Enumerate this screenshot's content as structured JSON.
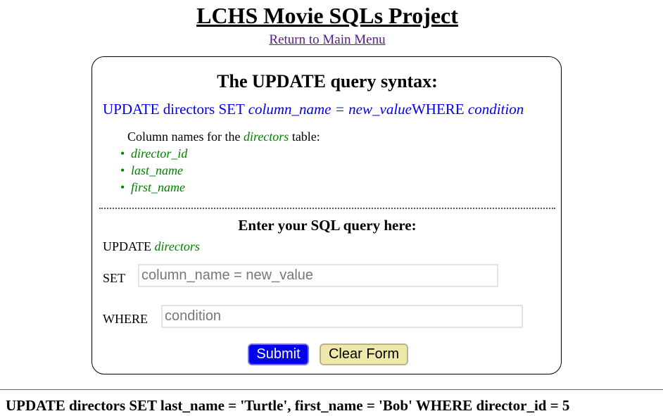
{
  "header": {
    "title": "LCHS Movie SQLs Project",
    "menu_link": "Return to Main Menu"
  },
  "syntax": {
    "title": "The UPDATE query syntax:",
    "kw_update": "UPDATE directors SET",
    "col_value": "column_name = new_value",
    "kw_where": "WHERE",
    "cond": "condition"
  },
  "columns": {
    "intro_prefix": "Column names for the",
    "table_name": "directors",
    "intro_suffix": "table:",
    "items": [
      "director_id",
      "last_name",
      "first_name"
    ]
  },
  "form": {
    "title": "Enter your SQL query here:",
    "update_kw": "UPDATE",
    "table_name": "directors",
    "set_label": "SET",
    "set_placeholder": "column_name = new_value",
    "set_value": "",
    "where_label": "WHERE",
    "where_placeholder": "condition",
    "where_value": "",
    "submit_label": "Submit",
    "clear_label": "Clear Form"
  },
  "result": {
    "query": "UPDATE directors SET last_name = 'Turtle', first_name = 'Bob' WHERE director_id = 5"
  },
  "colors": {
    "link": "#551a8b",
    "syntax": "#0000ee",
    "column": "#008000",
    "submit_bg": "#0000ee",
    "clear_bg": "#eee8aa"
  }
}
